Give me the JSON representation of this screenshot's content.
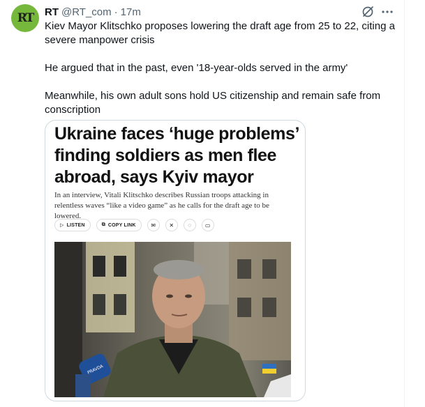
{
  "author": {
    "name": "RT",
    "handle": "@RT_com",
    "separator": "·",
    "time": "17m",
    "avatar_text": "RT",
    "avatar_color": "#75b83c"
  },
  "tweet": {
    "line1": "Kiev Mayor Klitschko proposes lowering the draft age from 25 to 22, citing a severe manpower crisis",
    "line2": "He argued that in the past, even '18-year-olds served in the army'",
    "line3": "Meanwhile, his own adult sons hold US citizenship and remain safe from conscription"
  },
  "card": {
    "headline": "Ukraine faces ‘huge problems’ finding soldiers as men flee abroad, says Kyiv mayor",
    "dek": "In an interview, Vitali Klitschko describes Russian troops attacking in relentless waves “like a video game” as he calls for the draft age to be lowered.",
    "listen_label": "LISTEN",
    "copy_link_label": "COPY LINK",
    "mic_label": "PRAVDA",
    "share_icons": [
      "mail-icon",
      "x-icon",
      "whatsapp-icon",
      "more-share-icon"
    ]
  },
  "icons": {
    "grok": "grok-icon",
    "more": "more-icon"
  }
}
